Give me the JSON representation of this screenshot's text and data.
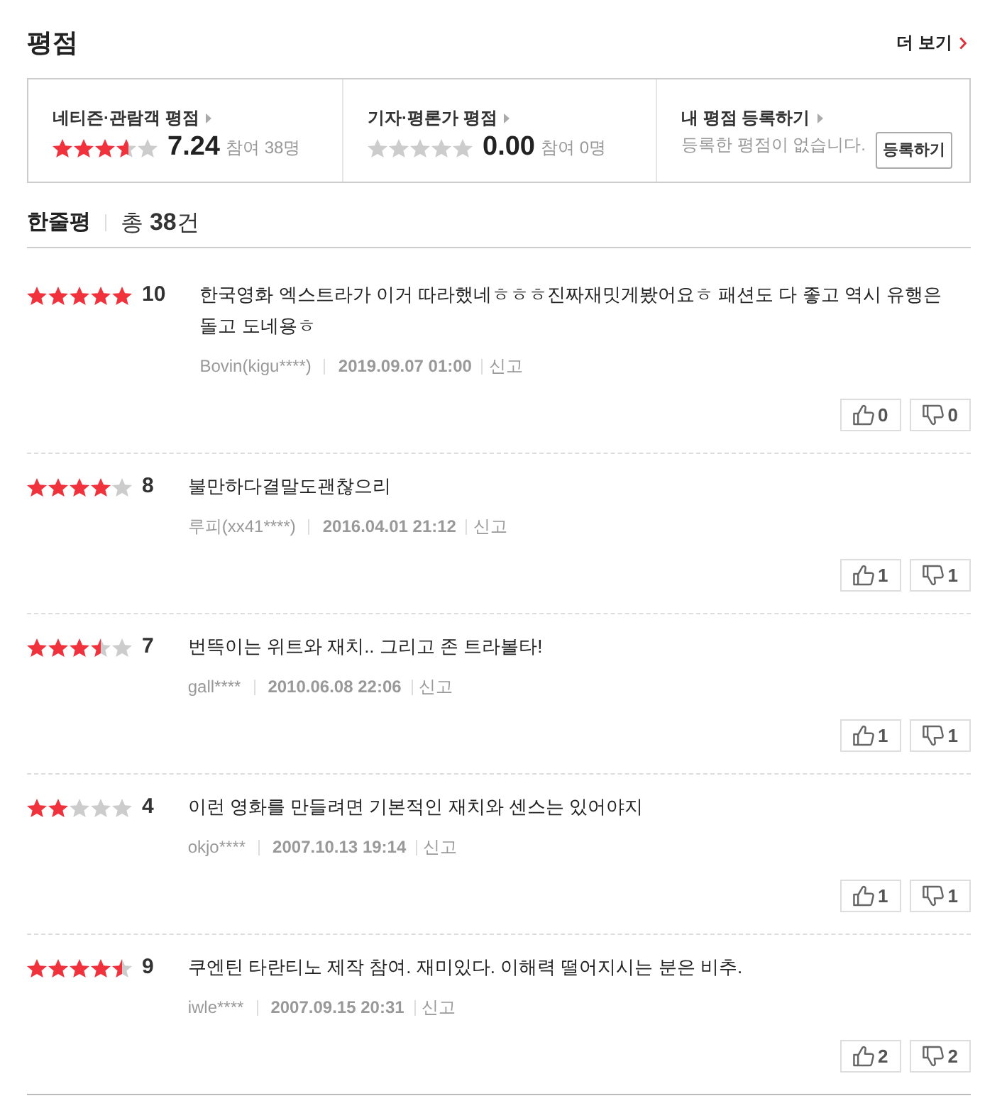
{
  "header": {
    "title": "평점",
    "more_link": "더 보기"
  },
  "summary": [
    {
      "kind": "score",
      "label": "네티즌·관람객 평점",
      "stars": 3.6,
      "score": "7.24",
      "participants": "참여 38명"
    },
    {
      "kind": "score",
      "label": "기자·평론가 평점",
      "stars": 0,
      "score": "0.00",
      "participants": "참여 0명"
    },
    {
      "kind": "register",
      "label": "내 평점 등록하기",
      "message": "등록한 평점이 없습니다.",
      "button": "등록하기"
    }
  ],
  "reviews_header": {
    "title": "한줄평",
    "total": "총 **38**건"
  },
  "reviews": [
    {
      "stars": 5,
      "score": "10",
      "text": "한국영화 엑스트라가 이거 따라했네ㅎㅎㅎ진짜재밋게봤어요ㅎ 패션도 다 좋고 역시 유행은 돌고 도네용ㅎ",
      "author": "Bovin(kigu****)",
      "date": "2019.09.07 01:00",
      "report": "신고",
      "likes": "0",
      "dislikes": "0"
    },
    {
      "stars": 4,
      "score": "8",
      "text": "불만하다결말도괜찮으리",
      "author": "루피(xx41****)",
      "date": "2016.04.01 21:12",
      "report": "신고",
      "likes": "1",
      "dislikes": "1"
    },
    {
      "stars": 3.5,
      "score": "7",
      "text": "번뜩이는 위트와 재치.. 그리고 존 트라볼타!",
      "author": "gall****",
      "date": "2010.06.08 22:06",
      "report": "신고",
      "likes": "1",
      "dislikes": "1"
    },
    {
      "stars": 2,
      "score": "4",
      "text": "이런 영화를 만들려면 기본적인 재치와 센스는 있어야지",
      "author": "okjo****",
      "date": "2007.10.13 19:14",
      "report": "신고",
      "likes": "1",
      "dislikes": "1"
    },
    {
      "stars": 4.5,
      "score": "9",
      "text": "쿠엔틴 타란티노 제작 참여. 재미있다. 이해력 떨어지시는 분은 비추.",
      "author": "iwle****",
      "date": "2007.09.15 20:31",
      "report": "신고",
      "likes": "2",
      "dislikes": "2"
    }
  ]
}
